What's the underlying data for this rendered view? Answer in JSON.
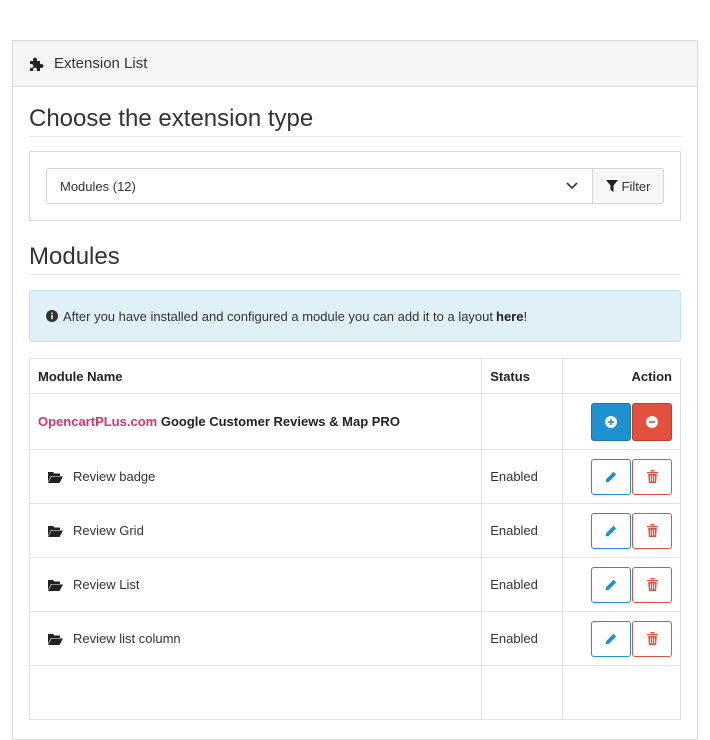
{
  "panel": {
    "title": "Extension List"
  },
  "choose": {
    "title": "Choose the extension type"
  },
  "filter": {
    "selected": "Modules (12)",
    "button_label": "Filter"
  },
  "modules": {
    "title": "Modules",
    "alert": {
      "prefix": "After you have installed and configured a module you can add it to a layout ",
      "link": "here",
      "suffix": "!"
    },
    "columns": {
      "name": "Module Name",
      "status": "Status",
      "action": "Action"
    },
    "group": {
      "brand": "OpencartPLus.com",
      "name": "Google Customer Reviews & Map PRO"
    },
    "rows": [
      {
        "name": "Review badge",
        "status": "Enabled"
      },
      {
        "name": "Review Grid",
        "status": "Enabled"
      },
      {
        "name": "Review List",
        "status": "Enabled"
      },
      {
        "name": "Review list column",
        "status": "Enabled"
      }
    ]
  },
  "colors": {
    "primary": "#1e91cf",
    "danger": "#e3503e",
    "brand": "#d6336c",
    "info_bg": "#dff0f6"
  },
  "icons": {
    "panel": "puzzle-icon",
    "filter": "filter-icon",
    "info": "info-circle-icon",
    "folder": "folder-open-icon",
    "install": "plus-circle-icon",
    "uninstall": "minus-circle-icon",
    "edit": "pencil-icon",
    "delete": "trash-icon"
  }
}
